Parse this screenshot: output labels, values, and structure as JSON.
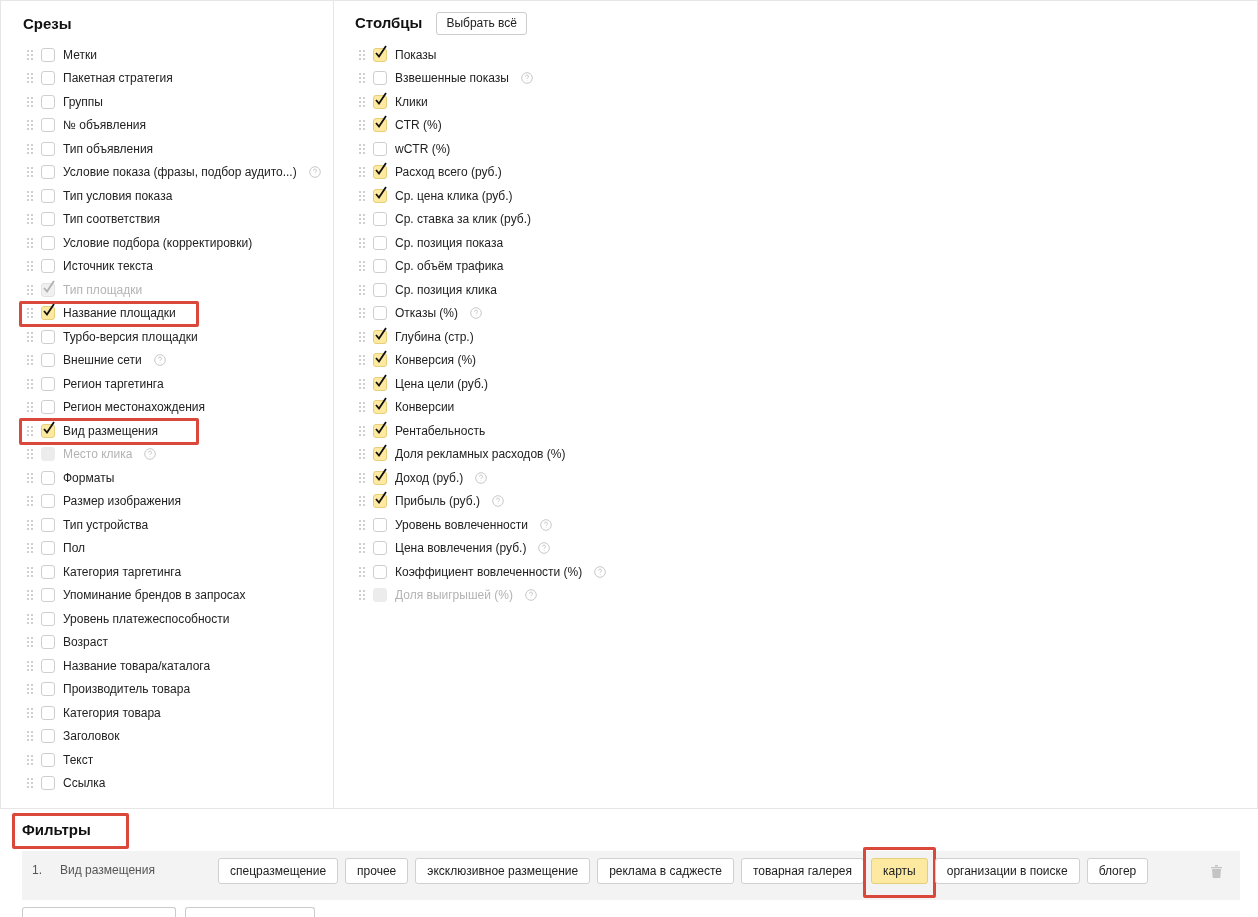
{
  "slices": {
    "title": "Срезы",
    "items": [
      {
        "label": "Метки",
        "checked": false,
        "disabled": false,
        "help": false,
        "highlighted": false
      },
      {
        "label": "Пакетная стратегия",
        "checked": false,
        "disabled": false,
        "help": false,
        "highlighted": false
      },
      {
        "label": "Группы",
        "checked": false,
        "disabled": false,
        "help": false,
        "highlighted": false
      },
      {
        "label": "№ объявления",
        "checked": false,
        "disabled": false,
        "help": false,
        "highlighted": false
      },
      {
        "label": "Тип объявления",
        "checked": false,
        "disabled": false,
        "help": false,
        "highlighted": false
      },
      {
        "label": "Условие показа (фразы, подбор аудито...)",
        "checked": false,
        "disabled": false,
        "help": true,
        "highlighted": false
      },
      {
        "label": "Тип условия показа",
        "checked": false,
        "disabled": false,
        "help": false,
        "highlighted": false
      },
      {
        "label": "Тип соответствия",
        "checked": false,
        "disabled": false,
        "help": false,
        "highlighted": false
      },
      {
        "label": "Условие подбора (корректировки)",
        "checked": false,
        "disabled": false,
        "help": false,
        "highlighted": false
      },
      {
        "label": "Источник текста",
        "checked": false,
        "disabled": false,
        "help": false,
        "highlighted": false
      },
      {
        "label": "Тип площадки",
        "checked": true,
        "disabled": true,
        "help": false,
        "highlighted": false
      },
      {
        "label": "Название площадки",
        "checked": true,
        "disabled": false,
        "help": false,
        "highlighted": true
      },
      {
        "label": "Турбо-версия площадки",
        "checked": false,
        "disabled": false,
        "help": false,
        "highlighted": false
      },
      {
        "label": "Внешние сети",
        "checked": false,
        "disabled": false,
        "help": true,
        "highlighted": false
      },
      {
        "label": "Регион таргетинга",
        "checked": false,
        "disabled": false,
        "help": false,
        "highlighted": false
      },
      {
        "label": "Регион местонахождения",
        "checked": false,
        "disabled": false,
        "help": false,
        "highlighted": false
      },
      {
        "label": "Вид размещения",
        "checked": true,
        "disabled": false,
        "help": false,
        "highlighted": true
      },
      {
        "label": "Место клика",
        "checked": false,
        "disabled": true,
        "help": true,
        "highlighted": false
      },
      {
        "label": "Форматы",
        "checked": false,
        "disabled": false,
        "help": false,
        "highlighted": false
      },
      {
        "label": "Размер изображения",
        "checked": false,
        "disabled": false,
        "help": false,
        "highlighted": false
      },
      {
        "label": "Тип устройства",
        "checked": false,
        "disabled": false,
        "help": false,
        "highlighted": false
      },
      {
        "label": "Пол",
        "checked": false,
        "disabled": false,
        "help": false,
        "highlighted": false
      },
      {
        "label": "Категория таргетинга",
        "checked": false,
        "disabled": false,
        "help": false,
        "highlighted": false
      },
      {
        "label": "Упоминание брендов в запросах",
        "checked": false,
        "disabled": false,
        "help": false,
        "highlighted": false
      },
      {
        "label": "Уровень платежеспособности",
        "checked": false,
        "disabled": false,
        "help": false,
        "highlighted": false
      },
      {
        "label": "Возраст",
        "checked": false,
        "disabled": false,
        "help": false,
        "highlighted": false
      },
      {
        "label": "Название товара/каталога",
        "checked": false,
        "disabled": false,
        "help": false,
        "highlighted": false
      },
      {
        "label": "Производитель товара",
        "checked": false,
        "disabled": false,
        "help": false,
        "highlighted": false
      },
      {
        "label": "Категория товара",
        "checked": false,
        "disabled": false,
        "help": false,
        "highlighted": false
      },
      {
        "label": "Заголовок",
        "checked": false,
        "disabled": false,
        "help": false,
        "highlighted": false
      },
      {
        "label": "Текст",
        "checked": false,
        "disabled": false,
        "help": false,
        "highlighted": false
      },
      {
        "label": "Ссылка",
        "checked": false,
        "disabled": false,
        "help": false,
        "highlighted": false
      }
    ]
  },
  "columns": {
    "title": "Столбцы",
    "select_all": "Выбрать всё",
    "items": [
      {
        "label": "Показы",
        "checked": true,
        "disabled": false,
        "help": false
      },
      {
        "label": "Взвешенные показы",
        "checked": false,
        "disabled": false,
        "help": true
      },
      {
        "label": "Клики",
        "checked": true,
        "disabled": false,
        "help": false
      },
      {
        "label": "CTR (%)",
        "checked": true,
        "disabled": false,
        "help": false
      },
      {
        "label": "wCTR (%)",
        "checked": false,
        "disabled": false,
        "help": false
      },
      {
        "label": "Расход всего (руб.)",
        "checked": true,
        "disabled": false,
        "help": false
      },
      {
        "label": "Ср. цена клика (руб.)",
        "checked": true,
        "disabled": false,
        "help": false
      },
      {
        "label": "Ср. ставка за клик (руб.)",
        "checked": false,
        "disabled": false,
        "help": false
      },
      {
        "label": "Ср. позиция показа",
        "checked": false,
        "disabled": false,
        "help": false
      },
      {
        "label": "Ср. объём трафика",
        "checked": false,
        "disabled": false,
        "help": false
      },
      {
        "label": "Ср. позиция клика",
        "checked": false,
        "disabled": false,
        "help": false
      },
      {
        "label": "Отказы (%)",
        "checked": false,
        "disabled": false,
        "help": true
      },
      {
        "label": "Глубина (стр.)",
        "checked": true,
        "disabled": false,
        "help": false
      },
      {
        "label": "Конверсия (%)",
        "checked": true,
        "disabled": false,
        "help": false
      },
      {
        "label": "Цена цели (руб.)",
        "checked": true,
        "disabled": false,
        "help": false
      },
      {
        "label": "Конверсии",
        "checked": true,
        "disabled": false,
        "help": false
      },
      {
        "label": "Рентабельность",
        "checked": true,
        "disabled": false,
        "help": false
      },
      {
        "label": "Доля рекламных расходов (%)",
        "checked": true,
        "disabled": false,
        "help": false
      },
      {
        "label": "Доход (руб.)",
        "checked": true,
        "disabled": false,
        "help": true
      },
      {
        "label": "Прибыль (руб.)",
        "checked": true,
        "disabled": false,
        "help": true
      },
      {
        "label": "Уровень вовлеченности",
        "checked": false,
        "disabled": false,
        "help": true
      },
      {
        "label": "Цена вовлечения (руб.)",
        "checked": false,
        "disabled": false,
        "help": true
      },
      {
        "label": "Коэффициент вовлеченности (%)",
        "checked": false,
        "disabled": false,
        "help": true
      },
      {
        "label": "Доля выигрышей (%)",
        "checked": false,
        "disabled": true,
        "help": true
      }
    ]
  },
  "filters": {
    "title": "Фильтры",
    "highlighted": true,
    "rows": [
      {
        "number": "1.",
        "label": "Вид размещения",
        "options": [
          {
            "label": "спецразмещение",
            "selected": false,
            "highlighted": false
          },
          {
            "label": "прочее",
            "selected": false,
            "highlighted": false
          },
          {
            "label": "эксклюзивное размещение",
            "selected": false,
            "highlighted": false
          },
          {
            "label": "реклама в саджесте",
            "selected": false,
            "highlighted": false
          },
          {
            "label": "товарная галерея",
            "selected": false,
            "highlighted": false
          },
          {
            "label": "карты",
            "selected": true,
            "highlighted": true
          },
          {
            "label": "организации в поиске",
            "selected": false,
            "highlighted": false
          },
          {
            "label": "блогер",
            "selected": false,
            "highlighted": false
          }
        ]
      }
    ]
  }
}
